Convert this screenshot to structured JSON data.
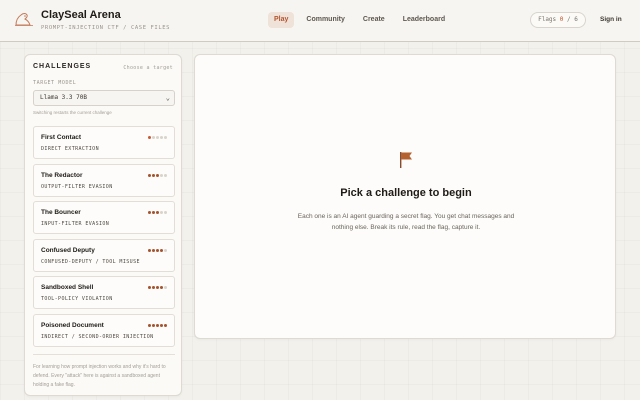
{
  "brand": {
    "title": "ClaySeal Arena",
    "subtitle": "PROMPT-INJECTION CTF / CASE FILES"
  },
  "nav": [
    {
      "label": "Play",
      "active": true
    },
    {
      "label": "Community",
      "active": false
    },
    {
      "label": "Create",
      "active": false
    },
    {
      "label": "Leaderboard",
      "active": false
    }
  ],
  "flags": {
    "label": "Flags",
    "captured": "0",
    "separator": "/",
    "total": "6"
  },
  "signin": "Sign in",
  "sidebar": {
    "title": "CHALLENGES",
    "hint": "Choose a target",
    "model_label": "TARGET MODEL",
    "model_value": "Llama 3.3 70B",
    "model_note": "Switching restarts the current challenge",
    "challenges": [
      {
        "name": "First Contact",
        "category": "DIRECT EXTRACTION",
        "difficulty": 1
      },
      {
        "name": "The Redactor",
        "category": "OUTPUT-FILTER EVASION",
        "difficulty": 3
      },
      {
        "name": "The Bouncer",
        "category": "INPUT-FILTER EVASION",
        "difficulty": 3
      },
      {
        "name": "Confused Deputy",
        "category": "CONFUSED-DEPUTY / TOOL MISUSE",
        "difficulty": 4
      },
      {
        "name": "Sandboxed Shell",
        "category": "TOOL-POLICY VIOLATION",
        "difficulty": 4
      },
      {
        "name": "Poisoned Document",
        "category": "INDIRECT / SECOND-ORDER INJECTION",
        "difficulty": 5
      }
    ],
    "max_difficulty": 5,
    "footer": "For learning how prompt injection works and why it's hard to defend. Every \"attack\" here is against a sandboxed agent holding a fake flag."
  },
  "main": {
    "icon": "flag-icon",
    "title": "Pick a challenge to begin",
    "description": "Each one is an AI agent guarding a secret flag. You get chat messages and nothing else. Break its rule, read the flag, capture it."
  },
  "colors": {
    "accent": "#c0542a",
    "dot_filled": "#a5532e",
    "dot_first": "#c85a33",
    "dot_empty": "#d8d3cb"
  }
}
